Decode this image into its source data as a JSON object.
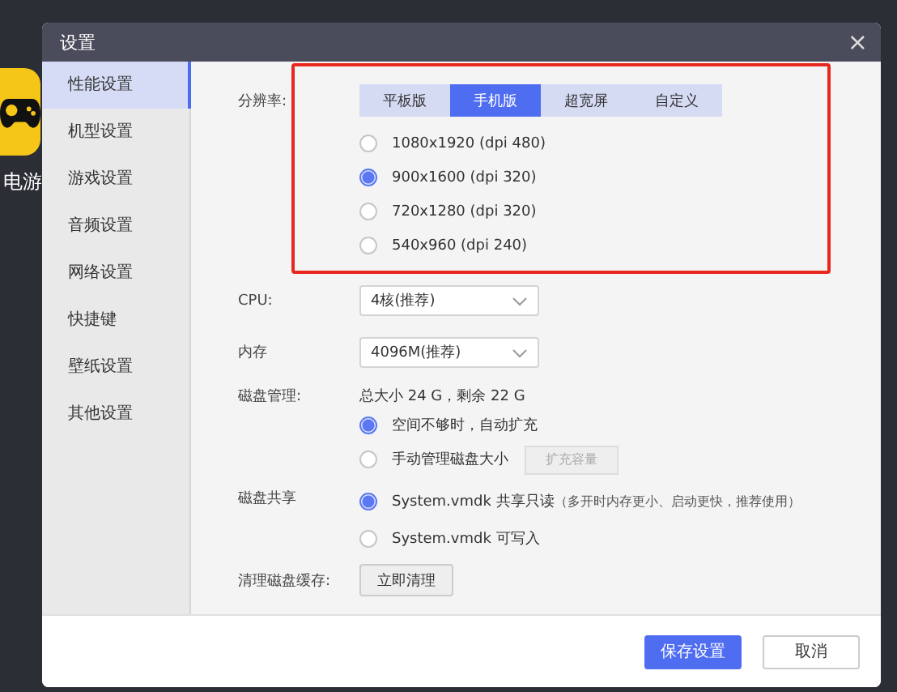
{
  "background_app": {
    "name": "电游"
  },
  "window": {
    "title": "设置",
    "close": "×"
  },
  "sidebar": {
    "items": [
      {
        "label": "性能设置",
        "selected": true
      },
      {
        "label": "机型设置",
        "selected": false
      },
      {
        "label": "游戏设置",
        "selected": false
      },
      {
        "label": "音频设置",
        "selected": false
      },
      {
        "label": "网络设置",
        "selected": false
      },
      {
        "label": "快捷键",
        "selected": false
      },
      {
        "label": "壁纸设置",
        "selected": false
      },
      {
        "label": "其他设置",
        "selected": false
      }
    ]
  },
  "resolution": {
    "label": "分辨率:",
    "highlighted": true,
    "tabs": [
      {
        "label": "平板版",
        "selected": false
      },
      {
        "label": "手机版",
        "selected": true
      },
      {
        "label": "超宽屏",
        "selected": false
      },
      {
        "label": "自定义",
        "selected": false
      }
    ],
    "options": [
      {
        "label": "1080x1920  (dpi 480)",
        "selected": false
      },
      {
        "label": "900x1600  (dpi 320)",
        "selected": true
      },
      {
        "label": "720x1280  (dpi 320)",
        "selected": false
      },
      {
        "label": "540x960  (dpi 240)",
        "selected": false
      }
    ]
  },
  "cpu": {
    "label": "CPU:",
    "value": "4核(推荐)"
  },
  "memory": {
    "label": "内存",
    "value": "4096M(推荐)"
  },
  "disk": {
    "label": "磁盘管理:",
    "summary": "总大小 24 G，剩余 22 G",
    "options": [
      {
        "label": "空间不够时，自动扩充",
        "selected": true
      },
      {
        "label": "手动管理磁盘大小",
        "selected": false,
        "button": {
          "label": "扩充容量",
          "disabled": true
        }
      }
    ]
  },
  "disk_share": {
    "label": "磁盘共享",
    "options": [
      {
        "label": "System.vmdk 共享只读",
        "note": "（多开时内存更小、启动更快，推荐使用）",
        "selected": true
      },
      {
        "label": "System.vmdk 可写入",
        "selected": false
      }
    ]
  },
  "cache": {
    "label": "清理磁盘缓存:",
    "button": "立即清理"
  },
  "footer": {
    "buttons": [
      {
        "label": "保存设置",
        "kind": "primary"
      },
      {
        "label": "取消",
        "kind": "secondary"
      }
    ]
  }
}
